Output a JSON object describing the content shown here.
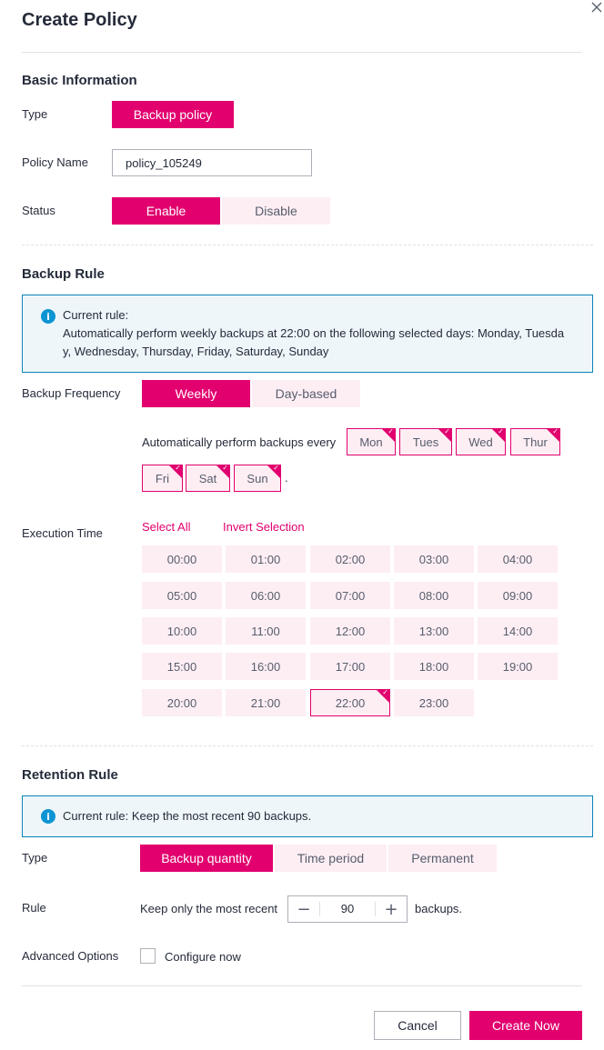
{
  "dialog": {
    "title": "Create Policy",
    "close_icon": "close-icon"
  },
  "basic": {
    "heading": "Basic Information",
    "type_label": "Type",
    "type_value": "Backup policy",
    "name_label": "Policy Name",
    "name_value": "policy_105249",
    "status_label": "Status",
    "status_options": [
      "Enable",
      "Disable"
    ],
    "status_selected": "Enable"
  },
  "backup_rule": {
    "heading": "Backup Rule",
    "info_icon": "info-icon",
    "info_line1": "Current rule:",
    "info_line2": "Automatically perform weekly backups at 22:00 on the following selected days: Monday, Tuesda",
    "info_line3": "y, Wednesday, Thursday, Friday, Saturday, Sunday",
    "frequency_label": "Backup Frequency",
    "frequency_options": [
      "Weekly",
      "Day-based"
    ],
    "frequency_selected": "Weekly",
    "days_prefix": "Automatically perform backups every",
    "days": [
      "Mon",
      "Tues",
      "Wed",
      "Thur",
      "Fri",
      "Sat",
      "Sun"
    ],
    "days_suffix": ".",
    "exec_label": "Execution Time",
    "select_all": "Select All",
    "invert_selection": "Invert Selection",
    "times": [
      "00:00",
      "01:00",
      "02:00",
      "03:00",
      "04:00",
      "05:00",
      "06:00",
      "07:00",
      "08:00",
      "09:00",
      "10:00",
      "11:00",
      "12:00",
      "13:00",
      "14:00",
      "15:00",
      "16:00",
      "17:00",
      "18:00",
      "19:00",
      "20:00",
      "21:00",
      "22:00",
      "23:00"
    ],
    "selected_time": "22:00"
  },
  "retention": {
    "heading": "Retention Rule",
    "info_text": "Current rule: Keep the most recent 90 backups.",
    "type_label": "Type",
    "type_options": [
      "Backup quantity",
      "Time period",
      "Permanent"
    ],
    "type_selected": "Backup quantity",
    "rule_label": "Rule",
    "rule_prefix": "Keep only the most recent",
    "rule_value": "90",
    "rule_suffix": "backups.",
    "minus_icon": "minus-icon",
    "plus_icon": "plus-icon",
    "advanced_label": "Advanced Options",
    "configure_label": "Configure now"
  },
  "footer": {
    "cancel": "Cancel",
    "create": "Create Now"
  },
  "colors": {
    "accent": "#e1006e",
    "accent_light": "#fdeef4",
    "info_border": "#0b83b8",
    "info_bg": "#eef6fa"
  }
}
